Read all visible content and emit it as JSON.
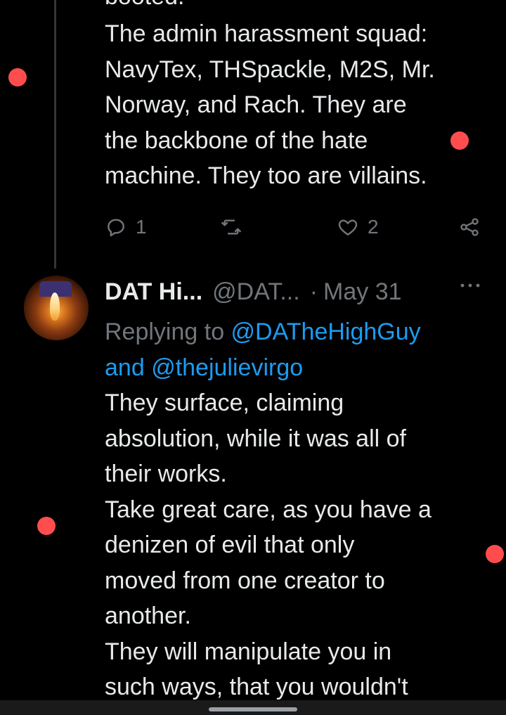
{
  "tweet1": {
    "cutoff_text": "booted.",
    "body": "The admin harassment squad:\nNavyTex, THSpackle, M2S, Mr.\nNorway, and Rach. They are\nthe backbone of the hate\nmachine. They too are villains.",
    "actions": {
      "reply_icon": "reply-icon",
      "reply_count": "1",
      "retweet_icon": "retweet-icon",
      "like_icon": "heart-icon",
      "like_count": "2",
      "share_icon": "share-icon"
    }
  },
  "tweet2": {
    "display_name": "DAT Hi...",
    "handle": "@DAT...",
    "separator": "·",
    "date": "May 31",
    "more_icon": "more-icon",
    "replying_to_prefix": "Replying to ",
    "replying_to_user1": "@DATheHighGuy",
    "replying_to_and": "and ",
    "replying_to_user2": "@thejulievirgo",
    "body": "They surface, claiming\nabsolution, while it was all of\ntheir works.\nTake great care, as you have a\ndenizen of evil that only\nmoved from one creator to\nanother.\nThey will manipulate you in\nsuch ways, that you wouldn't"
  },
  "colors": {
    "background": "#000000",
    "text": "#e7e9ea",
    "muted": "#71767b",
    "link": "#1d9bf0",
    "annotation_dot": "#ff4d4d"
  }
}
